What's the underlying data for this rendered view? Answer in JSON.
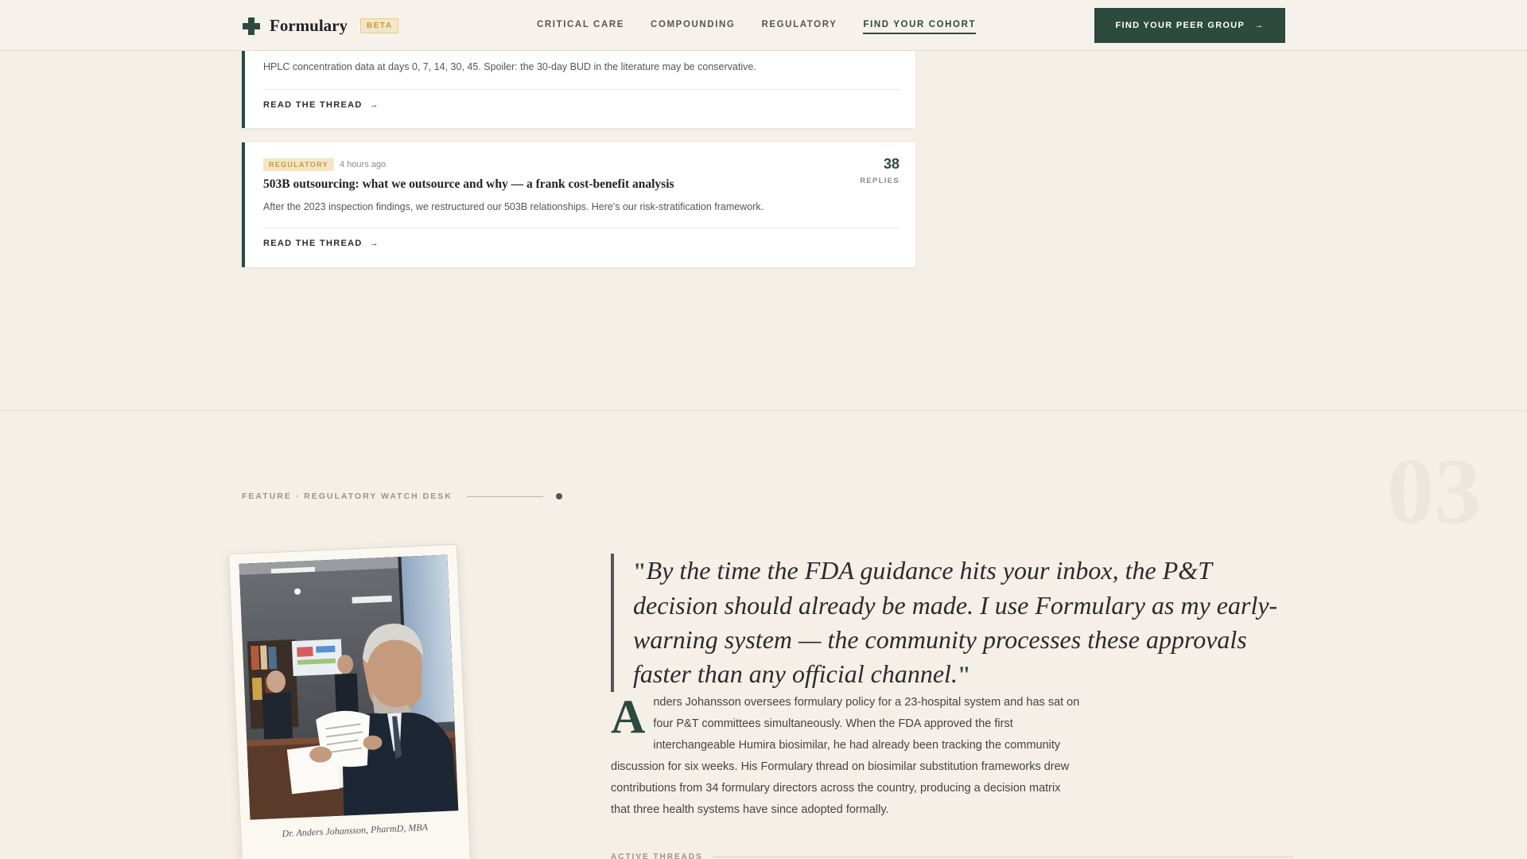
{
  "header": {
    "brand": "Formulary",
    "badge": "BETA",
    "nav": [
      "CRITICAL CARE",
      "COMPOUNDING",
      "REGULATORY",
      "FIND YOUR COHORT"
    ],
    "cta": "FIND YOUR PEER GROUP"
  },
  "threads": [
    {
      "excerpt": "HPLC concentration data at days 0, 7, 14, 30, 45. Spoiler: the 30-day BUD in the literature may be conservative.",
      "link": "READ THE THREAD"
    },
    {
      "tag": "REGULATORY",
      "time": "4 hours ago",
      "title": "503B outsourcing: what we outsource and why — a frank cost-benefit analysis",
      "excerpt": "After the 2023 inspection findings, we restructured our 503B relationships. Here's our risk-stratification framework.",
      "replies": "38",
      "replies_label": "REPLIES",
      "link": "READ THE THREAD"
    }
  ],
  "feature": {
    "section_number": "03",
    "eyebrow": "FEATURE · REGULATORY WATCH DESK",
    "caption": "Dr. Anders Johansson, PharmD, MBA",
    "quote": "By the time the FDA guidance hits your inbox, the P&T decision should already be made. I use Formulary as my early-warning system — the community processes these approvals faster than any official channel.",
    "bio_dropcap": "A",
    "bio": "nders Johansson oversees formulary policy for a 23-hospital system and has sat on four P&T committees simultaneously. When the FDA approved the first interchangeable Humira biosimilar, he had already been tracking the community discussion for six weeks. His Formulary thread on biosimilar substitution frameworks drew contributions from 34 formulary directors across the country, producing a decision matrix that three health systems have since adopted formally.",
    "active_threads": "ACTIVE THREADS"
  },
  "colors": {
    "accent": "#2c4a3e",
    "gold": "#c59a3e",
    "background": "#f4efe7"
  }
}
